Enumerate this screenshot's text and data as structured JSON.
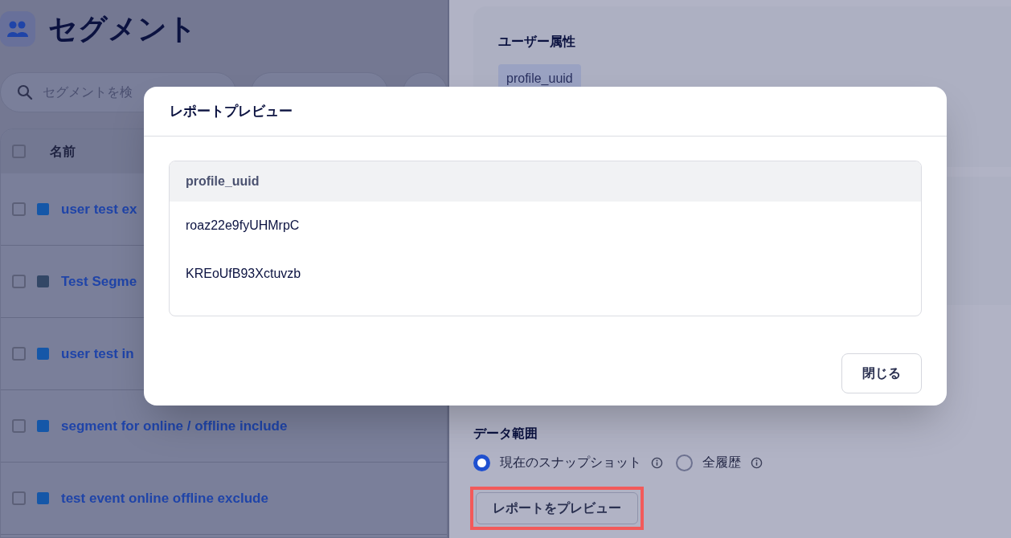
{
  "page": {
    "title": "セグメント"
  },
  "search": {
    "placeholder": "セグメントを検"
  },
  "table": {
    "columns": [
      "名前"
    ],
    "header_checked": false,
    "rows": [
      {
        "name": "user test ex",
        "color": "#1557a8",
        "checked": false
      },
      {
        "name": "Test Segme",
        "color": "#334766",
        "checked": false
      },
      {
        "name": "user test in",
        "color": "#1557a8",
        "checked": false
      },
      {
        "name": "segment for online / offline include",
        "color": "#1557a8",
        "checked": false
      },
      {
        "name": "test event online offline exclude",
        "color": "#1557a8",
        "checked": false
      }
    ]
  },
  "attributes": {
    "title": "ユーザー属性",
    "chips": [
      "profile_uuid"
    ]
  },
  "data_range": {
    "title": "データ範囲",
    "options": [
      {
        "label": "現在のスナップショット",
        "selected": true
      },
      {
        "label": "全履歴",
        "selected": false
      }
    ]
  },
  "preview_button": {
    "label": "レポートをプレビュー",
    "highlighted": true
  },
  "modal": {
    "title": "レポートプレビュー",
    "columns": [
      "profile_uuid"
    ],
    "rows": [
      "roaz22e9fyUHMrpC",
      "KREoUfB93Xctuvzb"
    ],
    "close_button": "閉じる"
  }
}
